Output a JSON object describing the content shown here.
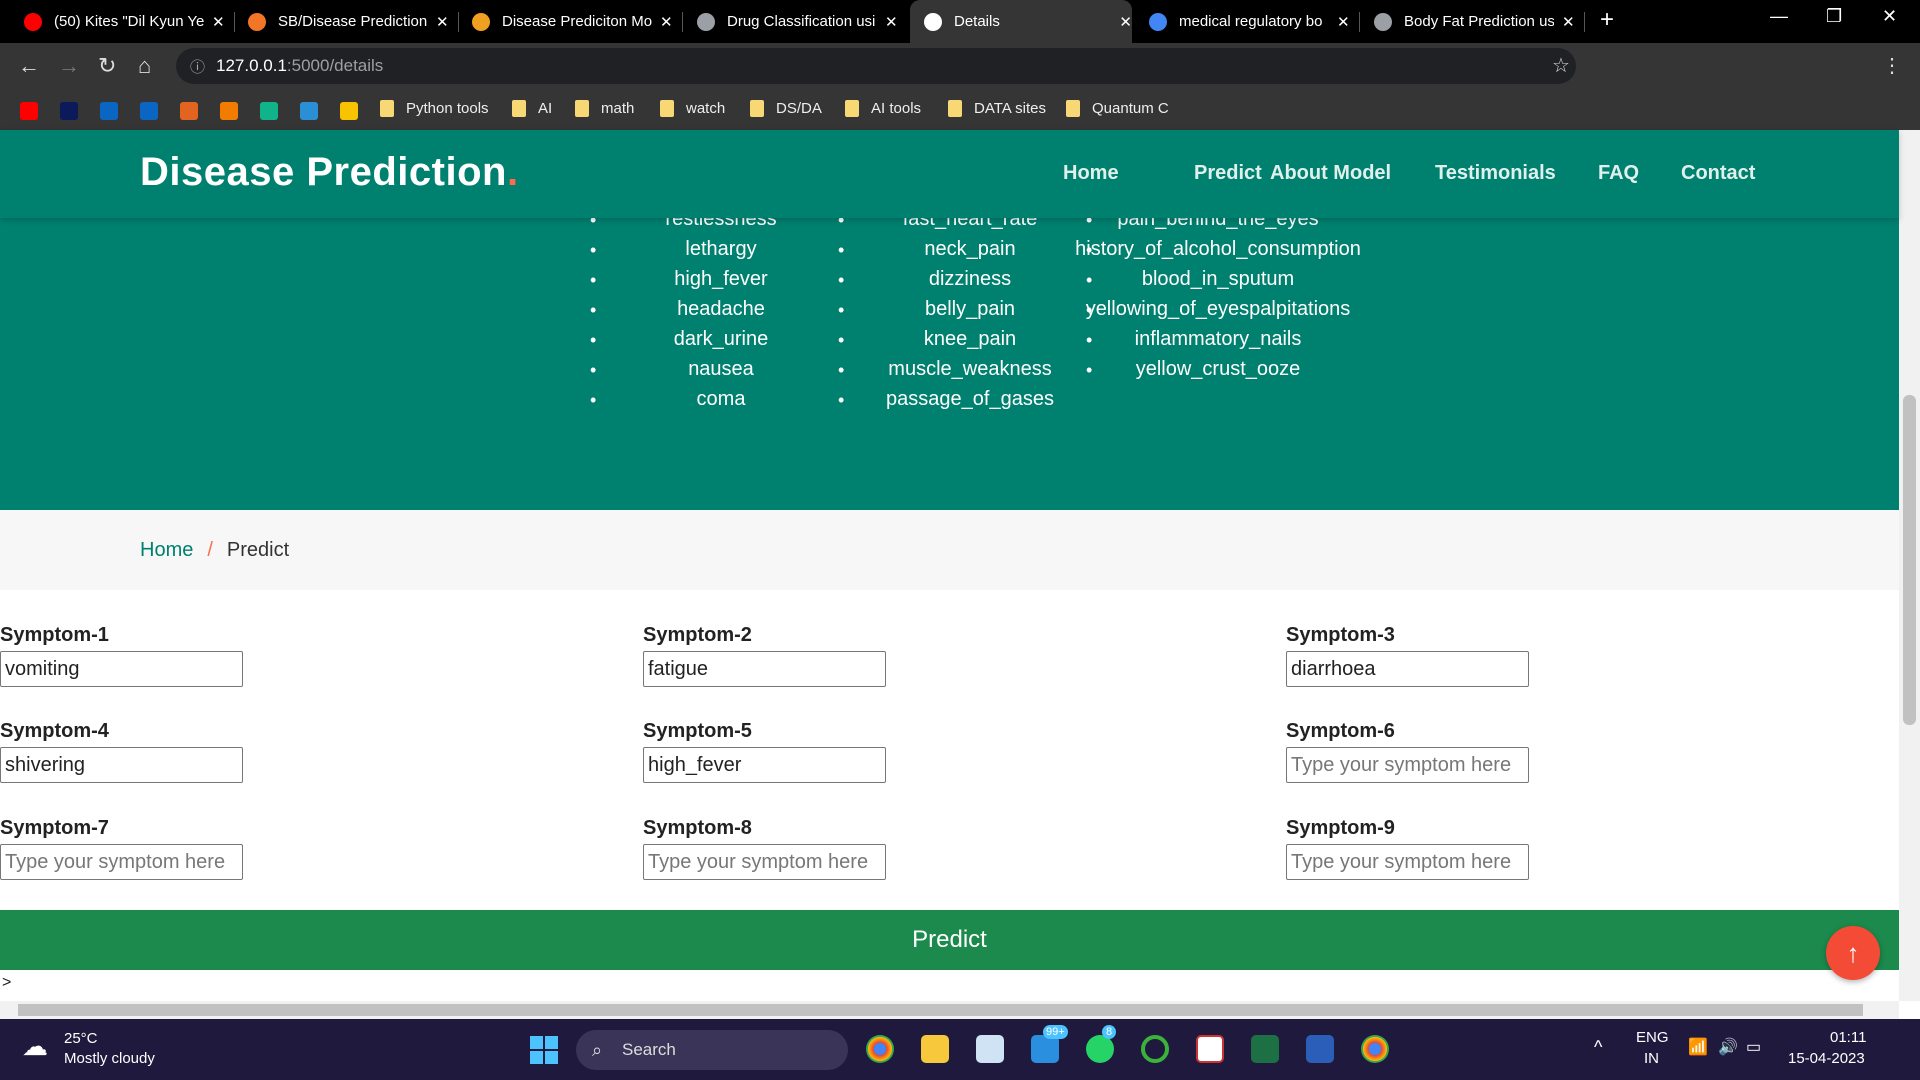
{
  "browser": {
    "tabs": [
      {
        "title": "(50) Kites \"Dil Kyun Ye",
        "icon": "youtube-icon",
        "color": "#ff0000"
      },
      {
        "title": "SB/Disease Prediction",
        "icon": "jupyter-icon",
        "color": "#f37626"
      },
      {
        "title": "Disease Prediciton Mo",
        "icon": "notebook-icon",
        "color": "#f0a020"
      },
      {
        "title": "Drug Classification usi",
        "icon": "globe-icon",
        "color": "#9aa0a6"
      },
      {
        "title": "Details",
        "icon": "health-icon",
        "color": "#ffffff"
      },
      {
        "title": "medical regulatory bo",
        "icon": "google-icon",
        "color": "#4285f4"
      },
      {
        "title": "Body Fat Prediction us",
        "icon": "globe-icon",
        "color": "#9aa0a6"
      }
    ],
    "url_host": "127.0.0.1",
    "url_path": ":5000/details",
    "bookmarks": [
      "Python tools",
      "AI",
      "math",
      "watch",
      "DS/DA",
      "AI tools",
      "DATA sites",
      "Quantum C"
    ]
  },
  "header": {
    "brand": "Disease Prediction",
    "brand_dot": ".",
    "nav": [
      "Home",
      "Predict",
      "About Model",
      "Testimonials",
      "FAQ",
      "Contact"
    ]
  },
  "symptom_lists": [
    [
      "restlessness",
      "lethargy",
      "high_fever",
      "headache",
      "dark_urine",
      "nausea",
      "coma"
    ],
    [
      "fast_heart_rate",
      "neck_pain",
      "dizziness",
      "belly_pain",
      "knee_pain",
      "muscle_weakness",
      "passage_of_gases"
    ],
    [
      "pain_behind_the_eyes",
      "history_of_alcohol_consumption",
      "blood_in_sputum",
      "yellowing_of_eyespalpitations",
      "inflammatory_nails",
      "yellow_crust_ooze"
    ]
  ],
  "breadcrumb": {
    "home": "Home",
    "separator": "/",
    "current": "Predict"
  },
  "form": {
    "placeholder": "Type your symptom here",
    "fields": [
      {
        "label": "Symptom-1",
        "value": "vomiting"
      },
      {
        "label": "Symptom-2",
        "value": "fatigue"
      },
      {
        "label": "Symptom-3",
        "value": "diarrhoea"
      },
      {
        "label": "Symptom-4",
        "value": "shivering"
      },
      {
        "label": "Symptom-5",
        "value": "high_fever"
      },
      {
        "label": "Symptom-6",
        "value": ""
      },
      {
        "label": "Symptom-7",
        "value": ""
      },
      {
        "label": "Symptom-8",
        "value": ""
      },
      {
        "label": "Symptom-9",
        "value": ""
      }
    ],
    "submit": "Predict"
  },
  "stray_text": ">",
  "taskbar": {
    "temp": "25°C",
    "weather": "Mostly cloudy",
    "search": "Search",
    "lang1": "ENG",
    "lang2": "IN",
    "time": "01:11",
    "date": "15-04-2023",
    "mail_badge": "99+",
    "whatsapp_badge": "8"
  },
  "colors": {
    "brand_teal": "#00806f",
    "accent": "#ff6b4a",
    "predict_green": "#1c8a4c"
  }
}
